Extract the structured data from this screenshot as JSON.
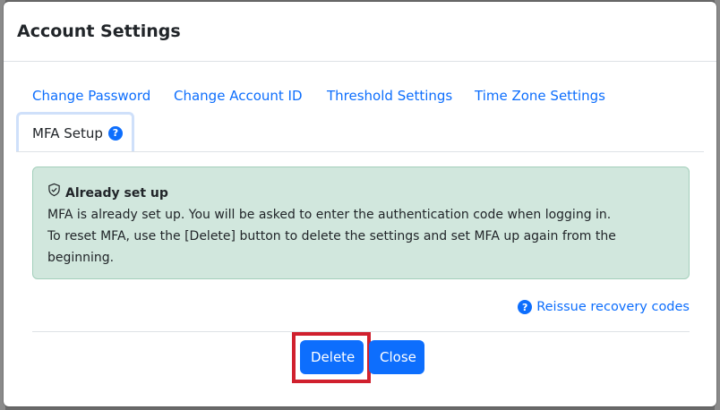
{
  "modal": {
    "title": "Account Settings"
  },
  "tabs": [
    {
      "label": "Change Password"
    },
    {
      "label": "Change Account ID"
    },
    {
      "label": "Threshold Settings"
    },
    {
      "label": "Time Zone Settings"
    },
    {
      "label": "MFA Setup",
      "active": true
    }
  ],
  "help_icon_glyph": "?",
  "alert": {
    "icon": "shield-check-icon",
    "heading": "Already set up",
    "line1": "MFA is already set up. You will be asked to enter the authentication code when logging in.",
    "line2": "To reset MFA, use the [Delete] button to delete the settings and set MFA up again from the beginning."
  },
  "reissue": {
    "label": "Reissue recovery codes",
    "icon": "question-circle-icon"
  },
  "footer": {
    "delete_label": "Delete",
    "close_label": "Close"
  },
  "colors": {
    "primary": "#0d6efd",
    "alert_bg": "#d1e7dd",
    "alert_border": "#a3cfbb",
    "highlight": "#d0202e"
  }
}
